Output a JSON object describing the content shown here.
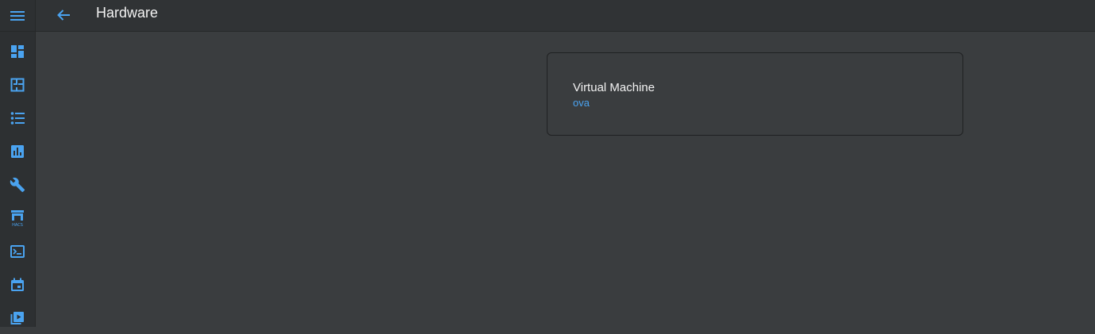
{
  "header": {
    "title": "Hardware"
  },
  "sidebar": {
    "items": [
      {
        "name": "dashboard"
      },
      {
        "name": "map"
      },
      {
        "name": "logbook"
      },
      {
        "name": "history"
      },
      {
        "name": "developer-tools"
      },
      {
        "name": "hacs",
        "label": "HACS"
      },
      {
        "name": "terminal"
      },
      {
        "name": "calendar"
      },
      {
        "name": "media"
      }
    ]
  },
  "card": {
    "title": "Virtual Machine",
    "subtitle": "ova"
  },
  "colors": {
    "accent": "#4aa3f0",
    "background": "#3a3d3f",
    "sidebar": "#2d3032",
    "header": "#303335"
  }
}
